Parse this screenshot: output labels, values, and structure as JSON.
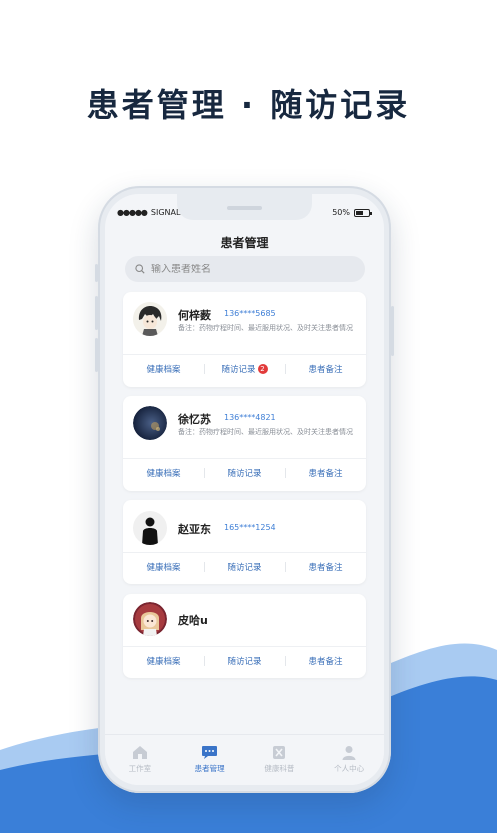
{
  "headline": "患者管理 · 随访记录",
  "status_bar": {
    "carrier": "SIGNAL",
    "signal_dots": "●●●●●",
    "battery": "50%"
  },
  "page_title": "患者管理",
  "search": {
    "placeholder": "输入患者姓名"
  },
  "patients": [
    {
      "name": "何梓薮",
      "phone": "136****5685",
      "note": "备注：药物疗程时间、最近服用状况、及时关注患者情况",
      "actions": {
        "records": "健康档案",
        "visits": "随访记录",
        "visits_badge": "2",
        "notes": "患者备注"
      }
    },
    {
      "name": "徐忆苏",
      "phone": "136****4821",
      "note": "备注：药物疗程时间、最近服用状况、及时关注患者情况",
      "actions": {
        "records": "健康档案",
        "visits": "随访记录",
        "notes": "患者备注"
      }
    },
    {
      "name": "赵亚东",
      "phone": "165****1254",
      "note": "",
      "actions": {
        "records": "健康档案",
        "visits": "随访记录",
        "notes": "患者备注"
      }
    },
    {
      "name": "皮哈u",
      "phone": "",
      "note": "",
      "actions": {
        "records": "健康档案",
        "visits": "随访记录",
        "notes": "患者备注"
      }
    }
  ],
  "tabs": [
    {
      "label": "工作室",
      "icon": "home-icon",
      "active": false
    },
    {
      "label": "患者管理",
      "icon": "chat-icon",
      "active": true
    },
    {
      "label": "健康科普",
      "icon": "book-icon",
      "active": false
    },
    {
      "label": "个人中心",
      "icon": "person-icon",
      "active": false
    }
  ],
  "colors": {
    "accent": "#3a74c8",
    "badge": "#e23b3b",
    "headline": "#17283f",
    "wave": "#3a7fd8"
  }
}
